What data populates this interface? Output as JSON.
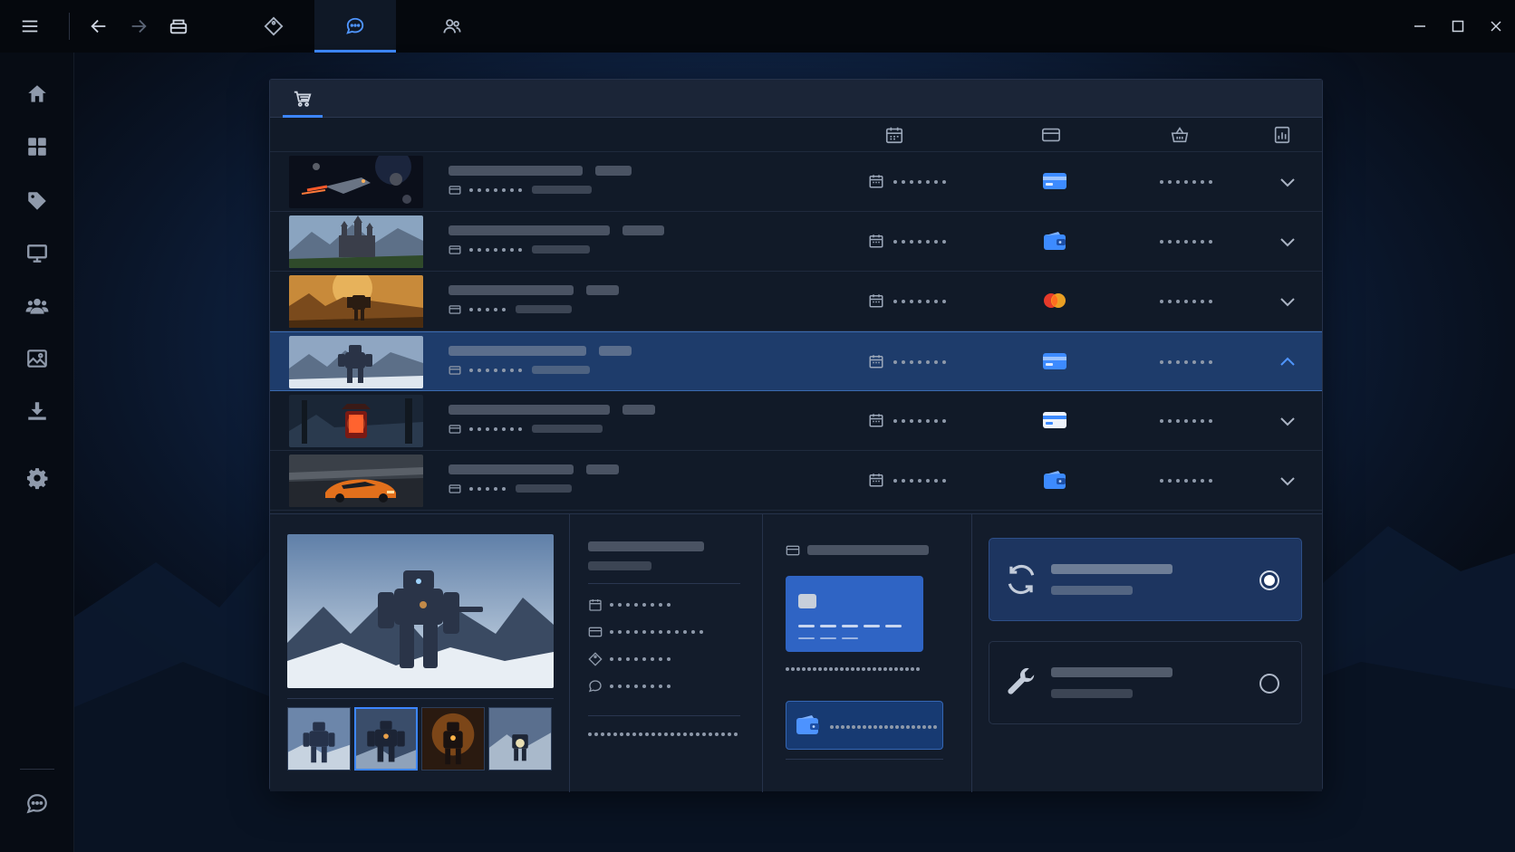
{
  "titlebar": {
    "tabs": [
      {
        "icon": "library-icon",
        "active": false
      },
      {
        "icon": "tag-icon",
        "active": false
      },
      {
        "icon": "chat-icon",
        "active": true
      },
      {
        "icon": "friends-icon",
        "active": false
      }
    ],
    "controls": [
      "minimize-icon",
      "maximize-icon",
      "close-icon"
    ]
  },
  "sidebar": {
    "items": [
      "home-icon",
      "apps-grid-icon",
      "tag-icon",
      "monitor-icon",
      "users-icon",
      "image-icon",
      "download-icon",
      "gear-icon"
    ],
    "footer": "chat-icon"
  },
  "panel": {
    "tab": "cart-icon",
    "columns": [
      "calendar-icon",
      "card-icon",
      "basket-icon",
      "report-icon"
    ]
  },
  "orders": [
    {
      "thumb": "spaceship-in-asteroid-field",
      "payment": "card",
      "expanded": false
    },
    {
      "thumb": "fantasy-castle-mountains",
      "payment": "wallet",
      "expanded": false
    },
    {
      "thumb": "robot-in-golden-canyon",
      "payment": "mastercard",
      "expanded": false
    },
    {
      "thumb": "mech-in-snow-mountains",
      "payment": "card",
      "expanded": true,
      "selected": true
    },
    {
      "thumb": "red-lantern-shrine",
      "payment": "card-white",
      "expanded": false
    },
    {
      "thumb": "orange-sports-car",
      "payment": "wallet",
      "expanded": false
    }
  ],
  "detail": {
    "hero": "mech-in-snow-mountains",
    "gallery": [
      "mech-snow",
      "mech-dusk",
      "mech-fire",
      "mech-lights"
    ],
    "active_gallery_index": 1,
    "info_icons": [
      "calendar-icon",
      "card-icon",
      "tag-icon",
      "chat-icon"
    ],
    "payment_options": [
      "card",
      "wallet"
    ],
    "fulfil_options": [
      {
        "icon": "refresh-icon",
        "selected": true
      },
      {
        "icon": "wrench-icon",
        "selected": false
      }
    ]
  },
  "colors": {
    "accent": "#3d86ff",
    "selected_row": "#1e3c6b",
    "card_blue": "#2f64c4"
  }
}
